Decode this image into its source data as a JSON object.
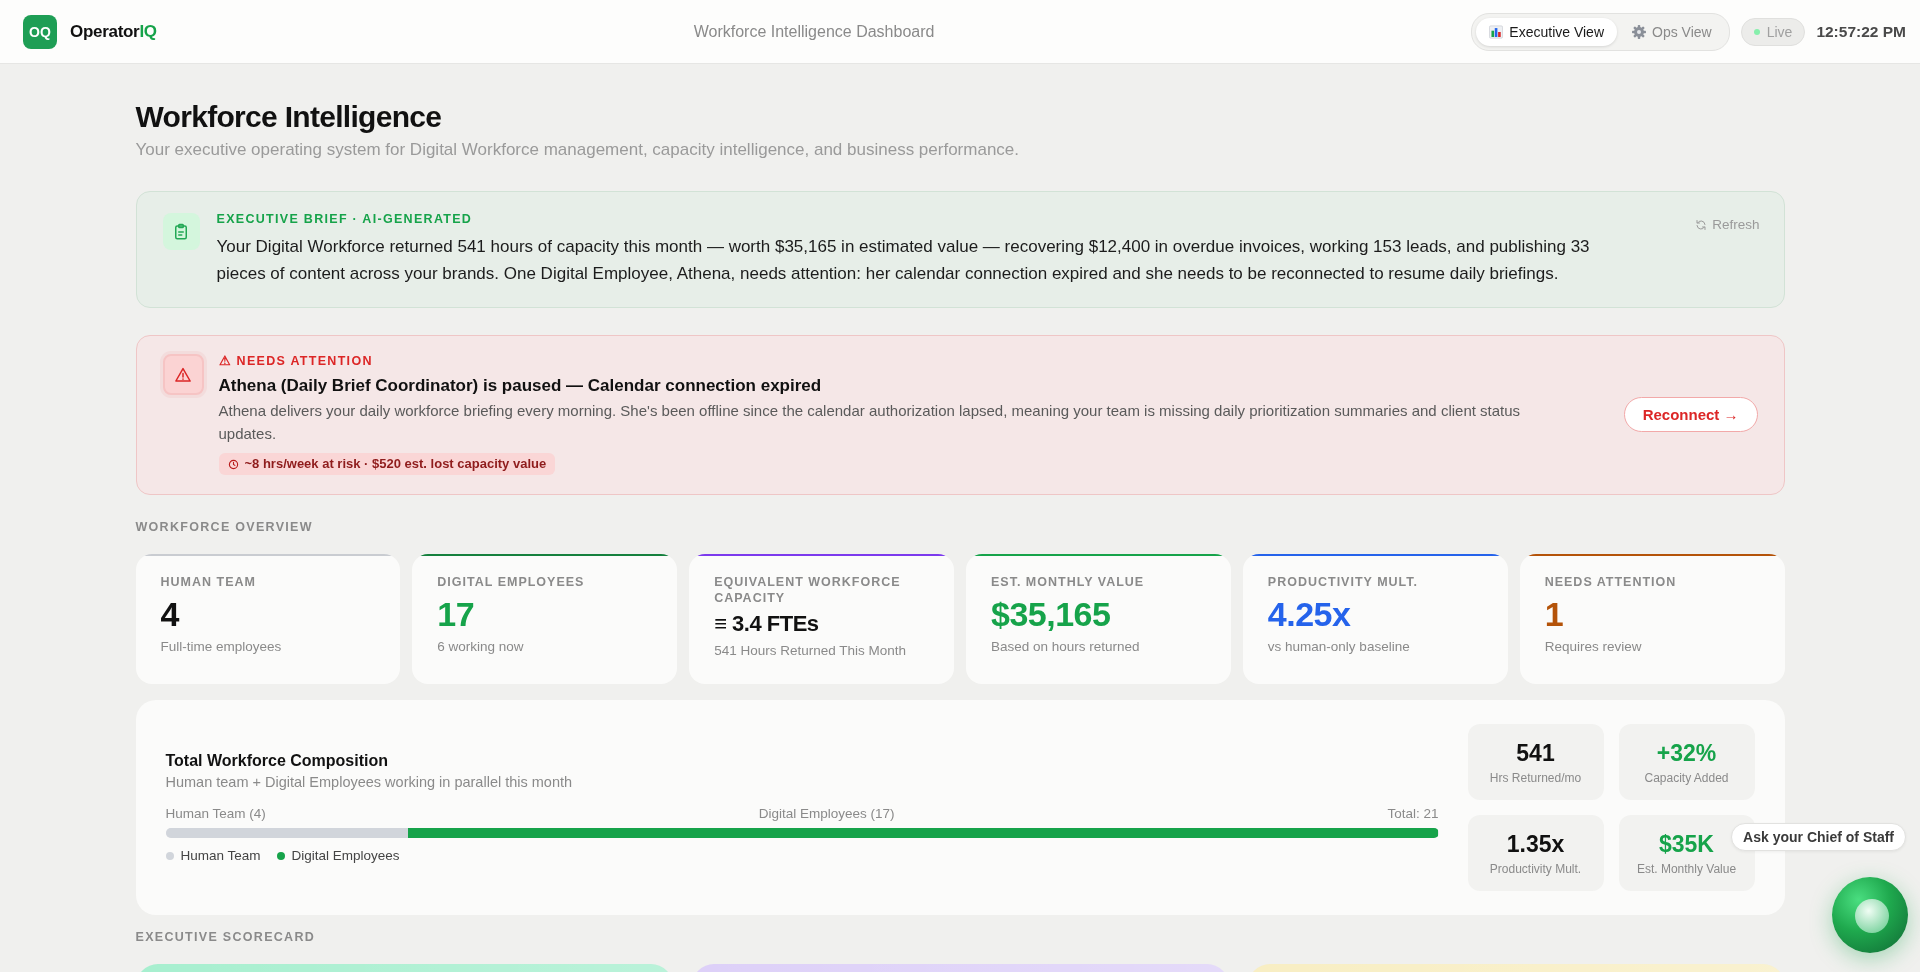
{
  "header": {
    "logo_mark": "OQ",
    "brand": "Operator",
    "brand_accent": "IQ",
    "title": "Workforce Intelligence Dashboard",
    "views": [
      {
        "label": "Executive View",
        "selected": true
      },
      {
        "label": "Ops View",
        "selected": false
      }
    ],
    "status": {
      "label": "Live",
      "live": true
    },
    "time": "12:57:22 PM"
  },
  "page": {
    "title": "Workforce Intelligence",
    "subtitle": "Your executive operating system for Digital Workforce management, capacity intelligence, and business performance."
  },
  "brief": {
    "label": "EXECUTIVE BRIEF · AI-GENERATED",
    "text": "Your Digital Workforce returned 541 hours of capacity this month — worth $35,165 in estimated value — recovering $12,400 in overdue invoices, working 153 leads, and publishing 33 pieces of content across your brands. One Digital Employee, Athena, needs attention: her calendar connection expired and she needs to be reconnected to resume daily briefings.",
    "action": "Refresh"
  },
  "alert": {
    "label": "⚠ NEEDS ATTENTION",
    "title": "Athena (Daily Brief Coordinator) is paused — Calendar connection expired",
    "text": "Athena delivers your daily workforce briefing every morning. She's been offline since the calendar authorization lapsed, meaning your team is missing daily prioritization summaries and client status updates.",
    "risk": "~8 hrs/week at risk · $520 est. lost capacity value",
    "action": "Reconnect →"
  },
  "overview": {
    "heading": "WORKFORCE OVERVIEW",
    "cards": [
      {
        "kind": "metric",
        "label": "HUMAN TEAM",
        "value": {
          "text": "4",
          "color": "#111111"
        },
        "note": "Full-time employees",
        "color": "#c9ccd1"
      },
      {
        "kind": "metric",
        "label": "DIGITAL EMPLOYEES",
        "value": {
          "text": "17",
          "color": "#16a34a"
        },
        "note": "6 working now",
        "color": "#15803d"
      },
      {
        "kind": "estimate",
        "label": "EQUIVALENT WORKFORCE CAPACITY",
        "value": {
          "text": "≡ 3.4 FTEs",
          "color": "#111111"
        },
        "note": "541 Hours Returned This Month",
        "color": "#7c3aed"
      },
      {
        "kind": "metric",
        "label": "EST. MONTHLY VALUE",
        "value": {
          "text": "$35,165",
          "color": "#16a34a"
        },
        "note": "Based on hours returned",
        "color": "#16a34a"
      },
      {
        "kind": "metric",
        "label": "PRODUCTIVITY MULT.",
        "value": {
          "text": "4.25x",
          "color": "#2563eb"
        },
        "note": "vs human-only baseline",
        "color": "#2563eb"
      },
      {
        "kind": "metric",
        "label": "NEEDS ATTENTION",
        "value": {
          "text": "1",
          "color": "#b45309"
        },
        "note": "Requires review",
        "color": "#b45309"
      }
    ]
  },
  "composition": {
    "title": "Total Workforce Composition",
    "subtitle": "Human team + Digital Employees working in parallel this month",
    "bar_labels": [
      "Human Team (4)",
      "Digital Employees (17)",
      "Total: 21"
    ],
    "segments": [
      {
        "level": 0.1905,
        "color": "#d1d5db"
      },
      {
        "level": 0.8095,
        "color": "#16a34a"
      }
    ],
    "legend": [
      {
        "label": "Human Team",
        "color": "#d1d5db"
      },
      {
        "label": "Digital Employees",
        "color": "#16a34a"
      }
    ],
    "stats": [
      {
        "value": "541",
        "label": "Hrs Returned/mo",
        "color": "#111111"
      },
      {
        "value": "+32%",
        "label": "Capacity Added",
        "color": "#16a34a"
      },
      {
        "value": "1.35x",
        "label": "Productivity Mult.",
        "color": "#111111"
      },
      {
        "value": "$35K",
        "label": "Est. Monthly Value",
        "color": "#16a34a"
      }
    ]
  },
  "scorecard": {
    "heading": "EXECUTIVE SCORECARD",
    "cards": [
      {
        "color": "#a7efcf"
      },
      {
        "color": "#ddd0f8"
      },
      {
        "color": "#f8eec3"
      }
    ]
  },
  "assistant": {
    "prompt": "Ask your Chief of Staff"
  }
}
